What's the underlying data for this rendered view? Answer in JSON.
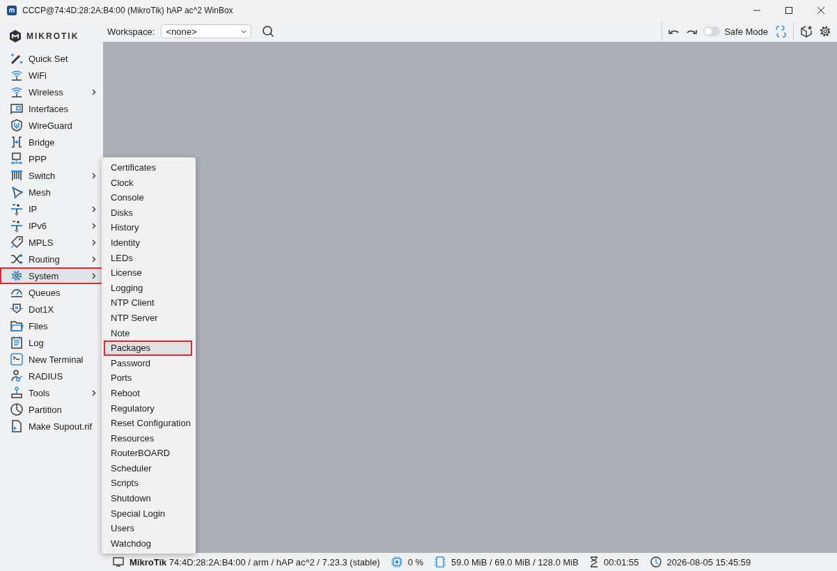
{
  "window": {
    "title": "CCCP@74:4D:28:2A:B4:00 (MikroTik) hAP ac^2 WinBox"
  },
  "logo": {
    "text": "MIKROTIK"
  },
  "toolbar": {
    "workspace_label": "Workspace:",
    "workspace_value": "<none>",
    "safe_mode": {
      "label": "Safe Mode",
      "on": false
    }
  },
  "sidebar": {
    "items": [
      {
        "label": "Quick Set",
        "has_submenu": false,
        "selected": false
      },
      {
        "label": "WiFi",
        "has_submenu": false,
        "selected": false
      },
      {
        "label": "Wireless",
        "has_submenu": true,
        "selected": false
      },
      {
        "label": "Interfaces",
        "has_submenu": false,
        "selected": false
      },
      {
        "label": "WireGuard",
        "has_submenu": false,
        "selected": false
      },
      {
        "label": "Bridge",
        "has_submenu": false,
        "selected": false
      },
      {
        "label": "PPP",
        "has_submenu": false,
        "selected": false
      },
      {
        "label": "Switch",
        "has_submenu": true,
        "selected": false
      },
      {
        "label": "Mesh",
        "has_submenu": false,
        "selected": false
      },
      {
        "label": "IP",
        "has_submenu": true,
        "selected": false
      },
      {
        "label": "IPv6",
        "has_submenu": true,
        "selected": false
      },
      {
        "label": "MPLS",
        "has_submenu": true,
        "selected": false
      },
      {
        "label": "Routing",
        "has_submenu": true,
        "selected": false
      },
      {
        "label": "System",
        "has_submenu": true,
        "selected": true
      },
      {
        "label": "Queues",
        "has_submenu": false,
        "selected": false
      },
      {
        "label": "Dot1X",
        "has_submenu": false,
        "selected": false
      },
      {
        "label": "Files",
        "has_submenu": false,
        "selected": false
      },
      {
        "label": "Log",
        "has_submenu": false,
        "selected": false
      },
      {
        "label": "New Terminal",
        "has_submenu": false,
        "selected": false
      },
      {
        "label": "RADIUS",
        "has_submenu": false,
        "selected": false
      },
      {
        "label": "Tools",
        "has_submenu": true,
        "selected": false
      },
      {
        "label": "Partition",
        "has_submenu": false,
        "selected": false
      },
      {
        "label": "Make Supout.rif",
        "has_submenu": false,
        "selected": false
      }
    ]
  },
  "submenu": {
    "items": [
      {
        "label": "Certificates",
        "selected": false
      },
      {
        "label": "Clock",
        "selected": false
      },
      {
        "label": "Console",
        "selected": false
      },
      {
        "label": "Disks",
        "selected": false
      },
      {
        "label": "History",
        "selected": false
      },
      {
        "label": "Identity",
        "selected": false
      },
      {
        "label": "LEDs",
        "selected": false
      },
      {
        "label": "License",
        "selected": false
      },
      {
        "label": "Logging",
        "selected": false
      },
      {
        "label": "NTP Client",
        "selected": false
      },
      {
        "label": "NTP Server",
        "selected": false
      },
      {
        "label": "Note",
        "selected": false
      },
      {
        "label": "Packages",
        "selected": true
      },
      {
        "label": "Password",
        "selected": false
      },
      {
        "label": "Ports",
        "selected": false
      },
      {
        "label": "Reboot",
        "selected": false
      },
      {
        "label": "Regulatory",
        "selected": false
      },
      {
        "label": "Reset Configuration",
        "selected": false
      },
      {
        "label": "Resources",
        "selected": false
      },
      {
        "label": "RouterBOARD",
        "selected": false
      },
      {
        "label": "Scheduler",
        "selected": false
      },
      {
        "label": "Scripts",
        "selected": false
      },
      {
        "label": "Shutdown",
        "selected": false
      },
      {
        "label": "Special Login",
        "selected": false
      },
      {
        "label": "Users",
        "selected": false
      },
      {
        "label": "Watchdog",
        "selected": false
      }
    ]
  },
  "status_bar": {
    "identity": "MikroTik",
    "board": "74:4D:28:2A:B4:00 / arm / hAP ac^2 / 7.23.3 (stable)",
    "cpu": "0 %",
    "memory": "59.0 MiB / 69.0 MiB / 128.0 MiB",
    "uptime": "00:01:55",
    "clock": "2026-08-05 15:45:59"
  }
}
